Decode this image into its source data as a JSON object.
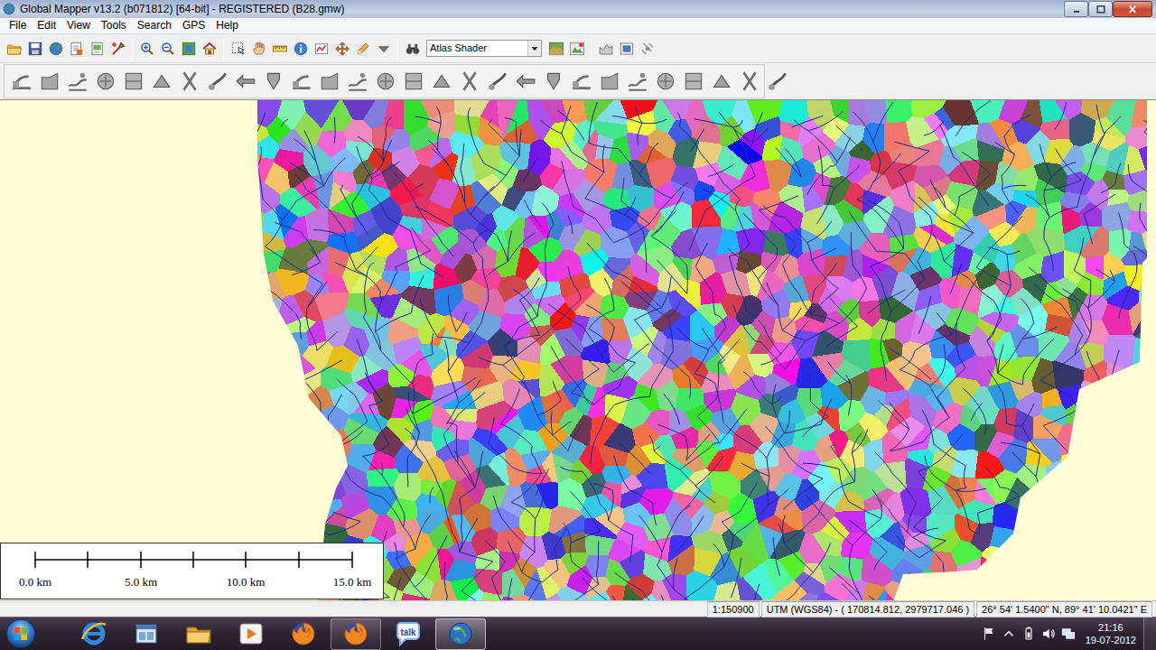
{
  "window": {
    "title": "Global Mapper v13.2 (b071812) [64-bit] - REGISTERED (B28.gmw)"
  },
  "menu": [
    "File",
    "Edit",
    "View",
    "Tools",
    "Search",
    "GPS",
    "Help"
  ],
  "toolbar": {
    "shader": "Atlas Shader"
  },
  "scale_bar": {
    "labels": [
      "0.0 km",
      "5.0 km",
      "10.0 km",
      "15.0 km"
    ]
  },
  "status_bar": {
    "scale": "1:150900",
    "projection": "UTM (WGS84) - ( 170814.812, 2979717.046 )",
    "geo": "26° 54' 1.5400\" N, 89° 41' 10.0421\" E"
  },
  "taskbar": {
    "apps": [
      {
        "kind": "ie",
        "open": false,
        "selected": false
      },
      {
        "kind": "window",
        "open": false,
        "selected": false
      },
      {
        "kind": "folder",
        "open": false,
        "selected": false
      },
      {
        "kind": "media",
        "open": false,
        "selected": false
      },
      {
        "kind": "firefox",
        "open": false,
        "selected": false
      },
      {
        "kind": "firefox",
        "open": true,
        "selected": false
      },
      {
        "kind": "talk",
        "label": "talk",
        "open": false,
        "selected": false
      },
      {
        "kind": "globe",
        "open": true,
        "selected": true
      }
    ],
    "clock": {
      "time": "21:16",
      "date": "19-07-2012"
    }
  }
}
